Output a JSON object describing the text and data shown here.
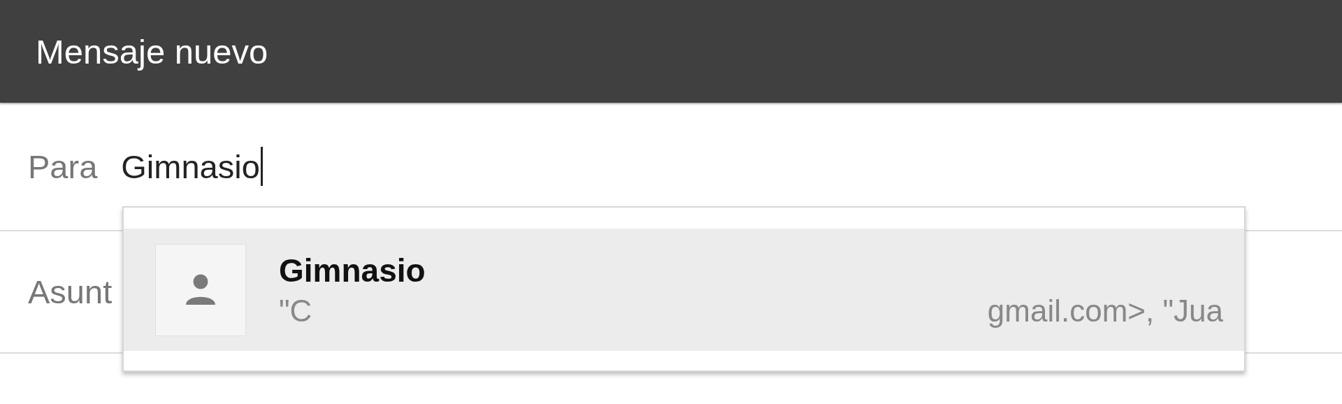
{
  "window": {
    "title": "Mensaje nuevo"
  },
  "to": {
    "label": "Para",
    "value": "Gimnasio"
  },
  "subject": {
    "label": "Asunt"
  },
  "suggestions": [
    {
      "name": "Gimnasio",
      "detail_start": "\"C",
      "detail_end": "gmail.com>, \"Jua",
      "selected": true
    }
  ]
}
